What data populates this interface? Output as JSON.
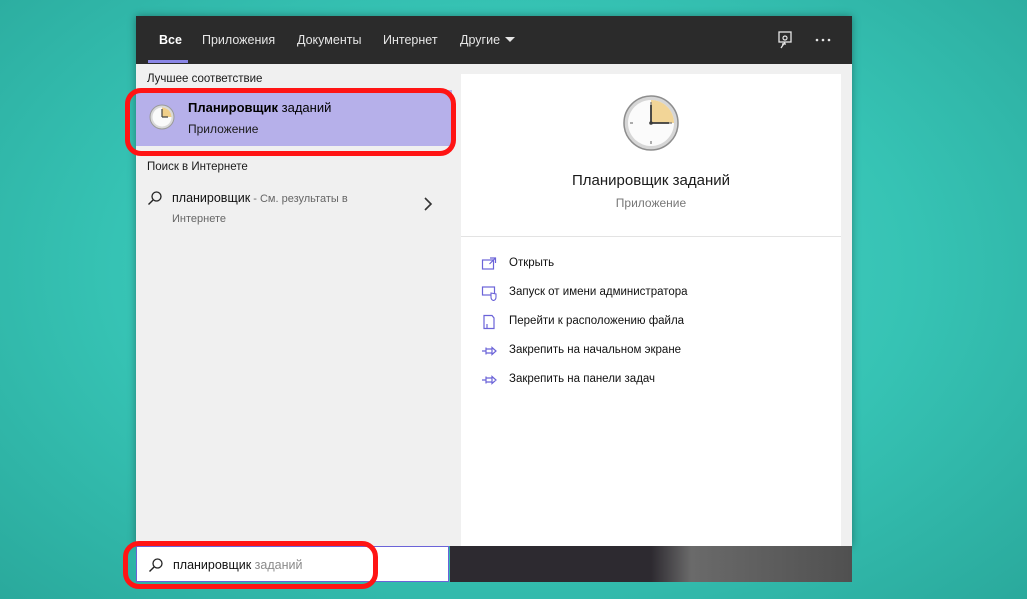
{
  "tabs": [
    {
      "label": "Все",
      "active": true
    },
    {
      "label": "Приложения"
    },
    {
      "label": "Документы"
    },
    {
      "label": "Интернет"
    },
    {
      "label": "Другие"
    }
  ],
  "topbar_icons": [
    "feedback-icon",
    "more-icon"
  ],
  "left": {
    "best_match_label": "Лучшее соответствие",
    "best_match": {
      "title_bold": "Планировщик",
      "title_rest": " заданий",
      "subtitle": "Приложение",
      "icon": "task-scheduler-clock-icon"
    },
    "web_label": "Поиск в Интернете",
    "web_item": {
      "query": "планировщик",
      "rest": " - См. результаты в Интернете"
    }
  },
  "right": {
    "app_name": "Планировщик заданий",
    "app_type": "Приложение",
    "actions": [
      {
        "label": "Открыть",
        "icon": "open-icon"
      },
      {
        "label": "Запуск от имени администратора",
        "icon": "admin-shield-icon"
      },
      {
        "label": "Перейти к расположению файла",
        "icon": "file-location-icon"
      },
      {
        "label": "Закрепить на начальном экране",
        "icon": "pin-icon"
      },
      {
        "label": "Закрепить на панели задач",
        "icon": "pin-icon"
      }
    ]
  },
  "search": {
    "typed": "планировщик",
    "completion": " заданий"
  },
  "colors": {
    "accent": "#8a86e6",
    "selection": "#b6b0ea",
    "highlight": "#ff1414",
    "background": "#36c3b4"
  }
}
